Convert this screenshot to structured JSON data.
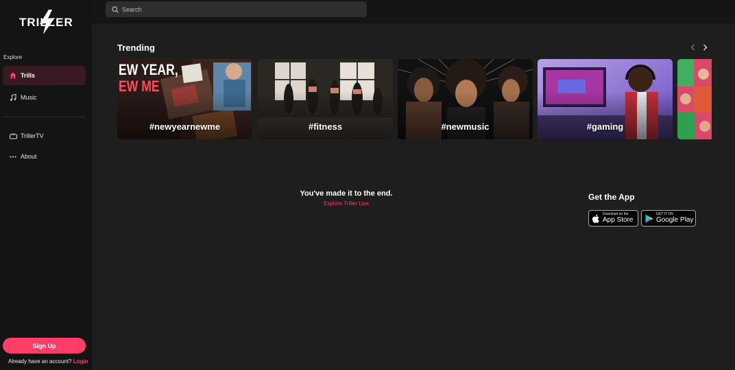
{
  "brand": {
    "name": "TRILLER"
  },
  "sidebar": {
    "section_label": "Explore",
    "items": [
      {
        "label": "Trills",
        "icon": "home-icon",
        "active": true
      },
      {
        "label": "Music",
        "icon": "music-note-icon",
        "active": false
      },
      {
        "label": "TrillerTV",
        "icon": "tv-icon",
        "active": false
      },
      {
        "label": "About",
        "icon": "more-dots-icon",
        "active": false
      }
    ],
    "signup_label": "Sign Up",
    "account_prompt": "Already have an account?",
    "login_label": "Login"
  },
  "search": {
    "placeholder": "Search"
  },
  "trending": {
    "title": "Trending",
    "cards": [
      {
        "tag": "#newyearnewme",
        "overlay": "EW YEAR,",
        "overlay2": "EW ME"
      },
      {
        "tag": "#fitness"
      },
      {
        "tag": "#newmusic"
      },
      {
        "tag": "#gaming"
      },
      {
        "tag": ""
      }
    ]
  },
  "end": {
    "title": "You've made it to the end.",
    "link": "Explore Triller Live"
  },
  "app": {
    "title": "Get the App",
    "appstore_small": "Download on the",
    "appstore_big": "App Store",
    "googleplay_small": "GET IT ON",
    "googleplay_big": "Google Play"
  },
  "colors": {
    "accent": "#ff3d68",
    "sidebar_bg": "#141414",
    "main_bg": "#1e1e1e",
    "active_item_bg": "#3a1a22"
  }
}
